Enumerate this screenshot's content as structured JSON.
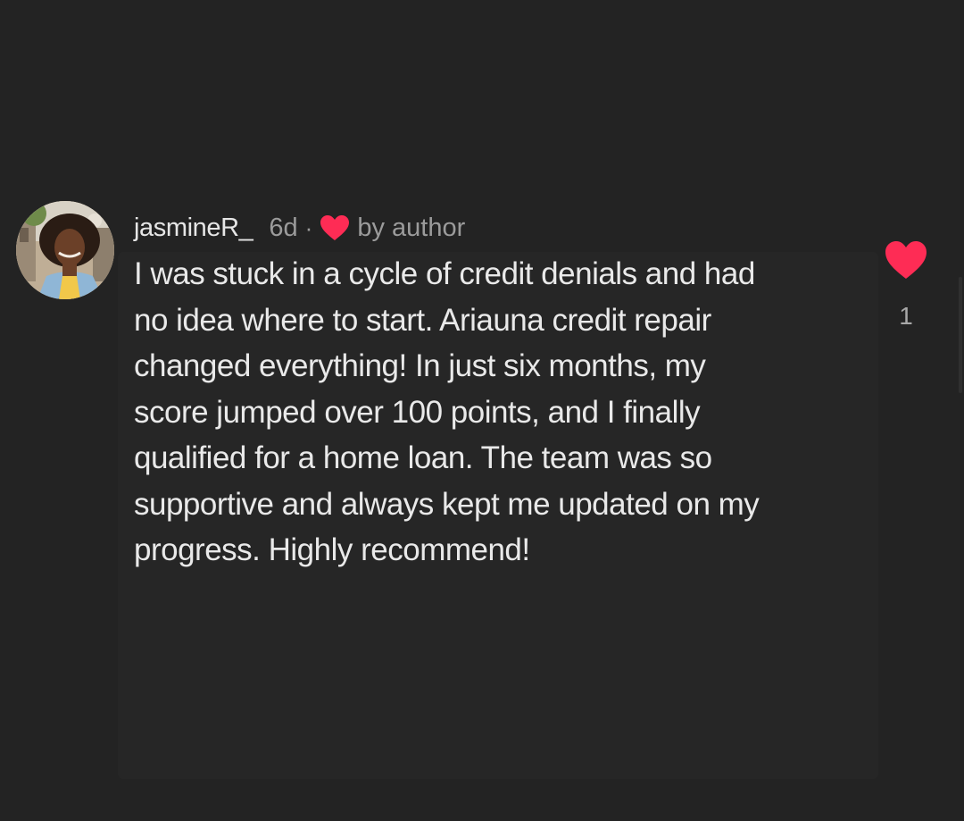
{
  "comment": {
    "username": "jasmineR_",
    "time_ago": "6d",
    "separator": "·",
    "author_badge_text": "by author",
    "body_lines": [
      "I was stuck in a cycle of credit denials and had",
      "no idea where to start. Ariauna credit repair",
      "changed everything! In just six months, my",
      "score jumped over 100 points, and I finally",
      "qualified for a home loan. The team was so",
      "supportive and always kept me updated on my",
      "progress. Highly recommend!"
    ],
    "like_count": "1",
    "avatar_icon": "user-avatar-photo",
    "author_like_icon": "heart-icon",
    "like_icon": "heart-icon"
  },
  "colors": {
    "background": "#232323",
    "heart": "#fe2c55",
    "text_primary": "#e9e9e9",
    "text_secondary": "#9b9b9b"
  }
}
